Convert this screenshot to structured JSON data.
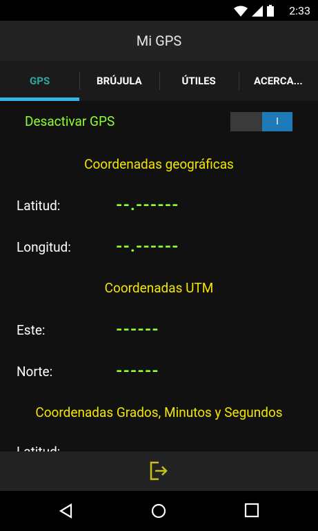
{
  "status": {
    "time": "2:33"
  },
  "app": {
    "title": "Mi GPS"
  },
  "tabs": [
    {
      "label": "GPS",
      "active": true
    },
    {
      "label": "BRÚJULA"
    },
    {
      "label": "ÚTILES"
    },
    {
      "label": "ACERCA..."
    }
  ],
  "gps_toggle": {
    "label": "Desactivar GPS",
    "switch_text": "I"
  },
  "geo": {
    "title": "Coordenadas geográficas",
    "lat_label": "Latitud:",
    "lat_value": "--.------",
    "lon_label": "Longitud:",
    "lon_value": "--.------"
  },
  "utm": {
    "title": "Coordenadas UTM",
    "este_label": "Este:",
    "este_value": "------",
    "norte_label": "Norte:",
    "norte_value": "------"
  },
  "dms": {
    "title": "Coordenadas Grados, Minutos y Segundos",
    "lat_label": "Latitud:"
  },
  "colors": {
    "accent": "#33b5e5",
    "green": "#8cff30",
    "yellow": "#f3e700"
  }
}
